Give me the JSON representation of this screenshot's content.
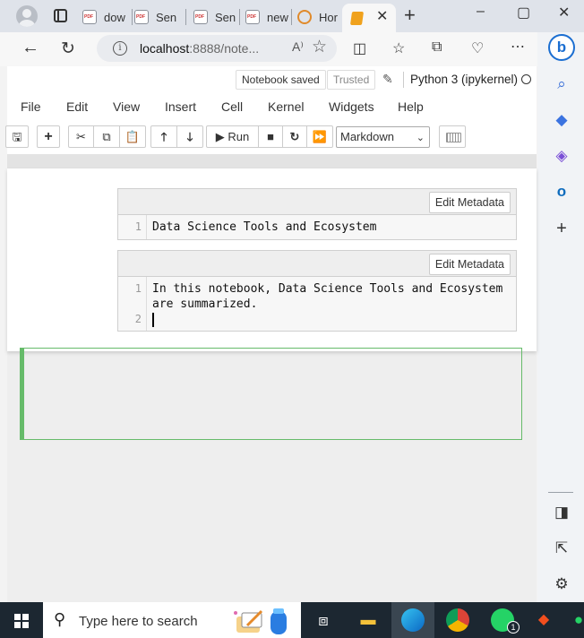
{
  "browser": {
    "tabs": [
      {
        "label": "dow"
      },
      {
        "label": "Sen"
      },
      {
        "label": "Sen"
      },
      {
        "label": "new"
      },
      {
        "label": "Hor"
      }
    ],
    "new_tab_label": "+",
    "url_host": "localhost",
    "url_path": ":8888/note...",
    "read_aloud_label": "A⁾",
    "window_controls": {
      "minimize": "–",
      "maximize": "▢",
      "close": "✕"
    }
  },
  "jupyter": {
    "status": {
      "saved": "Notebook saved",
      "trusted": "Trusted",
      "kernel": "Python 3 (ipykernel)"
    },
    "menu": [
      "File",
      "Edit",
      "View",
      "Insert",
      "Cell",
      "Kernel",
      "Widgets",
      "Help"
    ],
    "toolbar": {
      "run_label": "Run",
      "cell_type": "Markdown"
    },
    "cells": [
      {
        "meta_button": "Edit Metadata",
        "lines": [
          {
            "num": "1",
            "text": "Data Science Tools and Ecosystem"
          }
        ]
      },
      {
        "meta_button": "Edit Metadata",
        "lines": [
          {
            "num": "1",
            "text": "In this notebook, Data Science Tools and Ecosystem"
          },
          {
            "num": "",
            "text": "are summarized."
          },
          {
            "num": "2",
            "text": ""
          }
        ]
      }
    ]
  },
  "taskbar": {
    "search_placeholder": "Type here to search",
    "whatsapp_badge": "1"
  },
  "colors": {
    "selected_cell_border": "#66bb6a",
    "bing_blue": "#1b6ed1",
    "taskbar_bg": "#1c2731"
  }
}
